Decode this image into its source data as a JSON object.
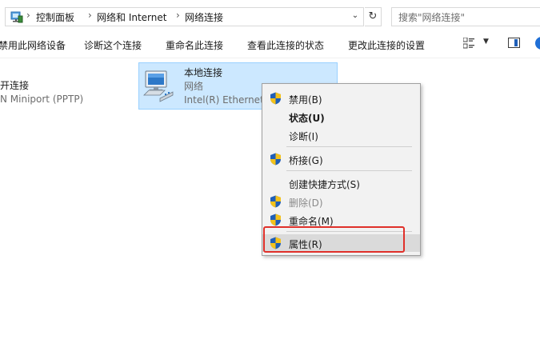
{
  "address": {
    "breadcrumbs": [
      "控制面板",
      "网络和 Internet",
      "网络连接"
    ],
    "search_placeholder": "搜索\"网络连接\""
  },
  "toolbar": {
    "items": [
      "禁用此网络设备",
      "诊断这个连接",
      "重命名此连接",
      "查看此连接的状态",
      "更改此连接的设置"
    ]
  },
  "left_items": {
    "line1": "开连接",
    "line2": "N Miniport (PPTP)"
  },
  "adapter": {
    "name": "本地连接",
    "network": "网络",
    "device": "Intel(R) Ethernet"
  },
  "context_menu": {
    "disable": "禁用(B)",
    "status": "状态(U)",
    "diagnose": "诊断(I)",
    "bridge": "桥接(G)",
    "shortcut": "创建快捷方式(S)",
    "delete": "删除(D)",
    "rename": "重命名(M)",
    "properties": "属性(R)"
  },
  "colors": {
    "selection_bg": "#cce8ff",
    "highlight_border": "#e0302a",
    "menu_bg": "#f2f2f2"
  }
}
